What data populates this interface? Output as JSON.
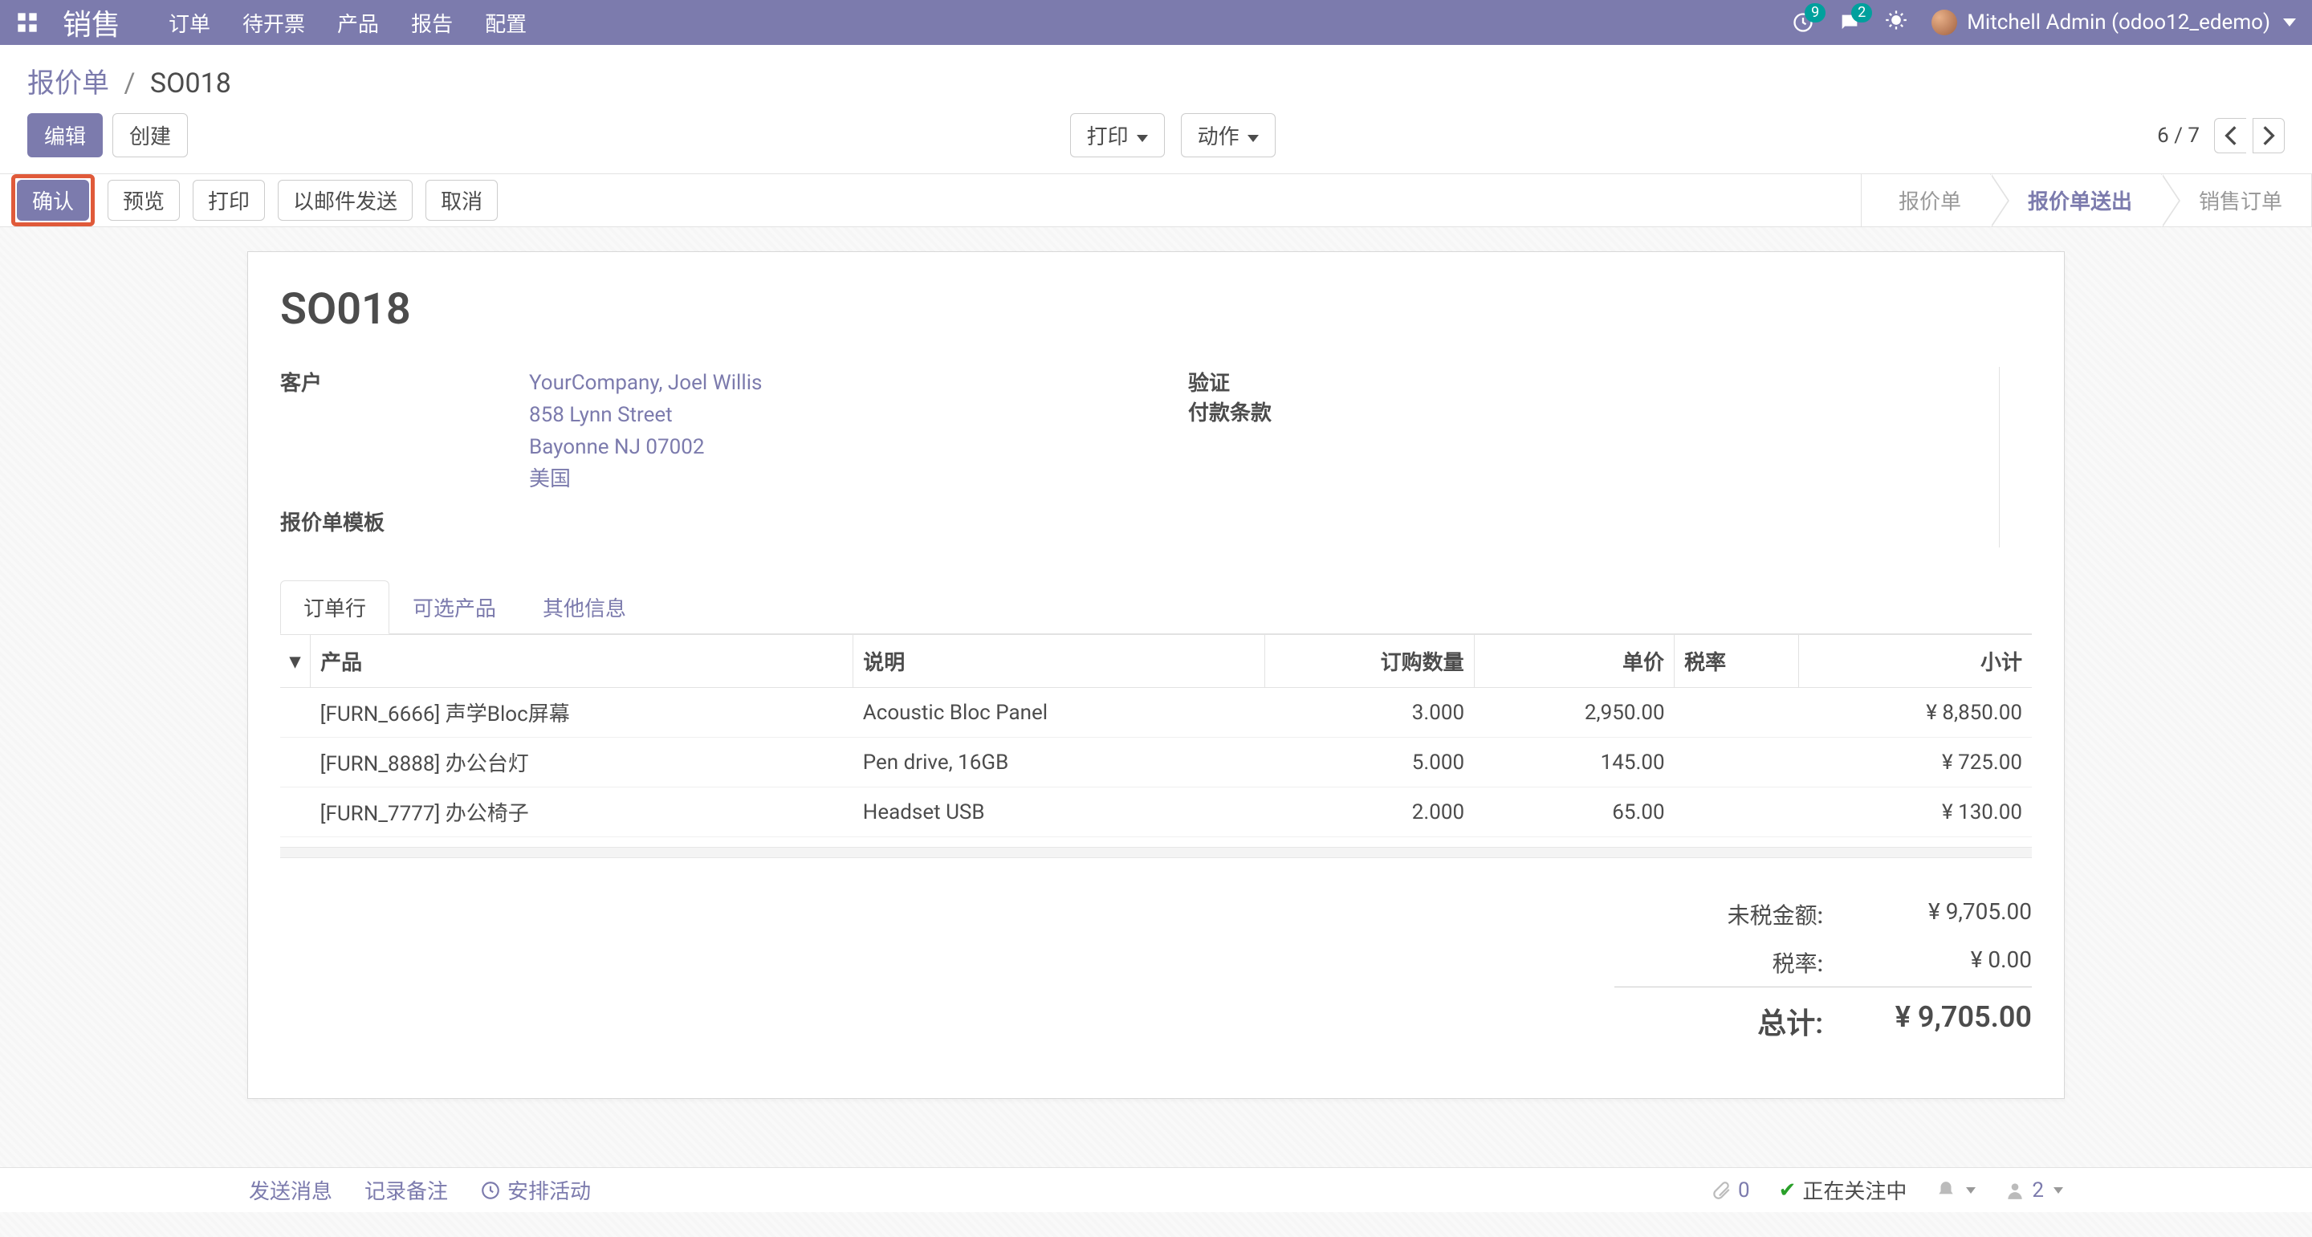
{
  "navbar": {
    "brand": "销售",
    "menu": [
      "订单",
      "待开票",
      "产品",
      "报告",
      "配置"
    ],
    "activities_badge": "9",
    "messages_badge": "2",
    "user": "Mitchell Admin (odoo12_edemo)"
  },
  "control_panel": {
    "breadcrumb_root": "报价单",
    "breadcrumb_current": "SO018",
    "edit": "编辑",
    "create": "创建",
    "print": "打印",
    "action": "动作",
    "pager": "6 / 7"
  },
  "status_bar": {
    "confirm": "确认",
    "preview": "预览",
    "print": "打印",
    "send_email": "以邮件发送",
    "cancel": "取消",
    "stages": [
      "报价单",
      "报价单送出",
      "销售订单"
    ],
    "active_stage_index": 1
  },
  "form": {
    "title": "SO018",
    "labels": {
      "customer": "客户",
      "quote_template": "报价单模板",
      "validation": "验证",
      "payment_terms": "付款条款"
    },
    "customer": {
      "line1": "YourCompany, Joel Willis",
      "line2": "858 Lynn Street",
      "line3": "Bayonne NJ 07002",
      "line4": "美国"
    }
  },
  "tabs": [
    "订单行",
    "可选产品",
    "其他信息"
  ],
  "table": {
    "headers": {
      "product": "产品",
      "description": "说明",
      "qty": "订购数量",
      "price": "单价",
      "tax": "税率",
      "subtotal": "小计"
    },
    "rows": [
      {
        "product": "[FURN_6666] 声学Bloc屏幕",
        "description": "Acoustic Bloc Panel",
        "qty": "3.000",
        "price": "2,950.00",
        "tax": "",
        "subtotal": "¥ 8,850.00"
      },
      {
        "product": "[FURN_8888] 办公台灯",
        "description": "Pen drive, 16GB",
        "qty": "5.000",
        "price": "145.00",
        "tax": "",
        "subtotal": "¥ 725.00"
      },
      {
        "product": "[FURN_7777] 办公椅子",
        "description": "Headset USB",
        "qty": "2.000",
        "price": "65.00",
        "tax": "",
        "subtotal": "¥ 130.00"
      }
    ]
  },
  "totals": {
    "untaxed_label": "未税金额:",
    "untaxed_value": "¥ 9,705.00",
    "tax_label": "税率:",
    "tax_value": "¥ 0.00",
    "total_label": "总计:",
    "total_value": "¥ 9,705.00"
  },
  "chatter": {
    "send_message": "发送消息",
    "log_note": "记录备注",
    "schedule_activity": "安排活动",
    "attach_count": "0",
    "following": "正在关注中",
    "followers_count": "2"
  }
}
